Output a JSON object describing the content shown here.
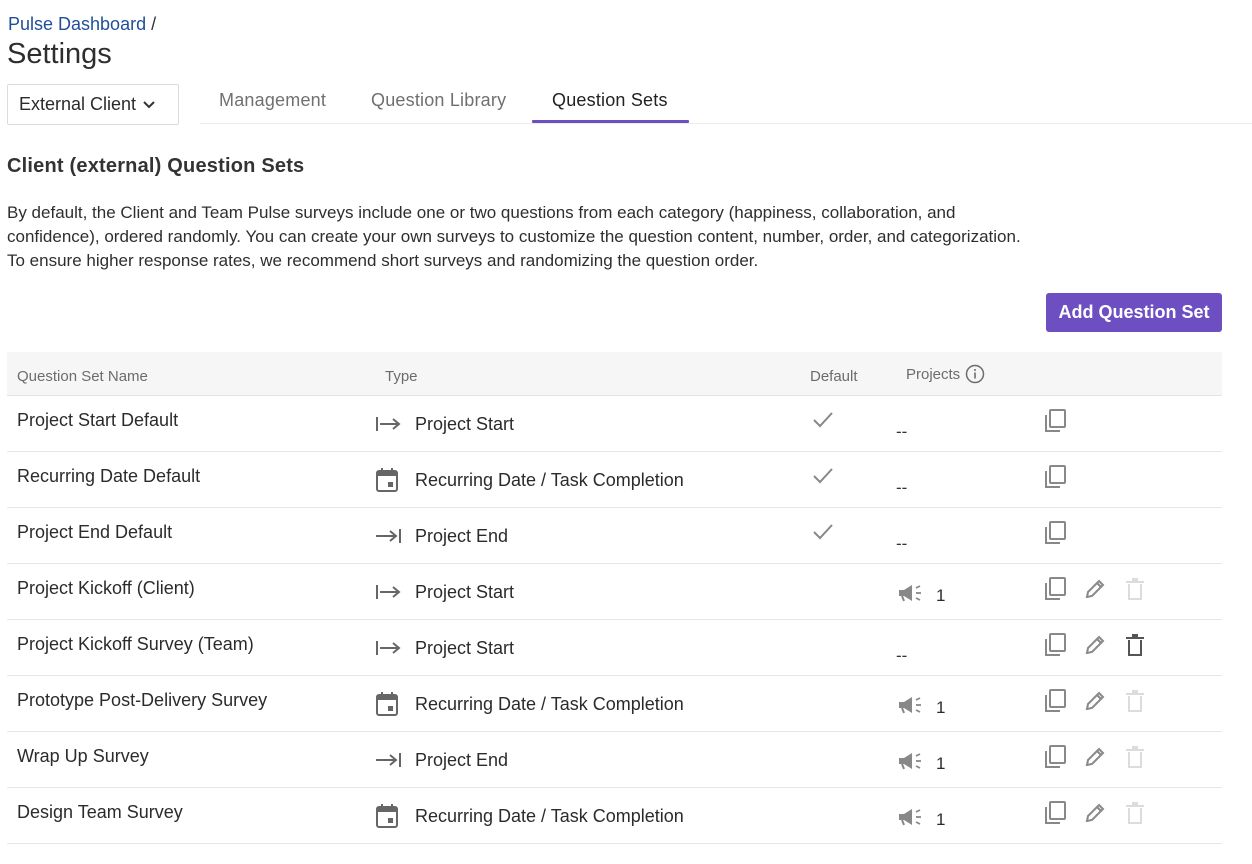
{
  "breadcrumb": {
    "parent": "Pulse Dashboard",
    "separator": " /"
  },
  "page_title": "Settings",
  "client_select": {
    "value": "External Client"
  },
  "tabs": [
    {
      "label": "Management",
      "active": false
    },
    {
      "label": "Question Library",
      "active": false
    },
    {
      "label": "Question Sets",
      "active": true
    }
  ],
  "section_title": "Client (external) Question Sets",
  "description": [
    "By default, the Client and Team Pulse surveys include one or two questions from each category (happiness, collaboration, and",
    "confidence), ordered randomly. You can create your own surveys to customize the question content, number, order, and categorization.",
    "To ensure higher response rates, we recommend short surveys and randomizing the question order."
  ],
  "add_button_label": "Add Question Set",
  "accent_color": "#6d4fc2",
  "table": {
    "headers": {
      "name": "Question Set Name",
      "type": "Type",
      "default": "Default",
      "projects": "Projects"
    },
    "rows": [
      {
        "name": "Project Start Default",
        "type": "Project Start",
        "type_icon": "arrow-from-bar-icon",
        "default": true,
        "projects": "--",
        "editable": false,
        "deletable": false
      },
      {
        "name": "Recurring Date Default",
        "type": "Recurring Date / Task Completion",
        "type_icon": "calendar-icon",
        "default": true,
        "projects": "--",
        "editable": false,
        "deletable": false
      },
      {
        "name": "Project End Default",
        "type": "Project End",
        "type_icon": "arrow-to-bar-icon",
        "default": true,
        "projects": "--",
        "editable": false,
        "deletable": false
      },
      {
        "name": "Project Kickoff (Client)",
        "type": "Project Start",
        "type_icon": "arrow-from-bar-icon",
        "default": false,
        "projects": "1",
        "editable": true,
        "deletable": false
      },
      {
        "name": "Project Kickoff Survey (Team)",
        "type": "Project Start",
        "type_icon": "arrow-from-bar-icon",
        "default": false,
        "projects": "--",
        "editable": true,
        "deletable": true
      },
      {
        "name": "Prototype Post-Delivery Survey",
        "type": "Recurring Date / Task Completion",
        "type_icon": "calendar-icon",
        "default": false,
        "projects": "1",
        "editable": true,
        "deletable": false
      },
      {
        "name": "Wrap Up Survey",
        "type": "Project End",
        "type_icon": "arrow-to-bar-icon",
        "default": false,
        "projects": "1",
        "editable": true,
        "deletable": false
      },
      {
        "name": "Design Team Survey",
        "type": "Recurring Date / Task Completion",
        "type_icon": "calendar-icon",
        "default": false,
        "projects": "1",
        "editable": true,
        "deletable": false
      }
    ]
  }
}
